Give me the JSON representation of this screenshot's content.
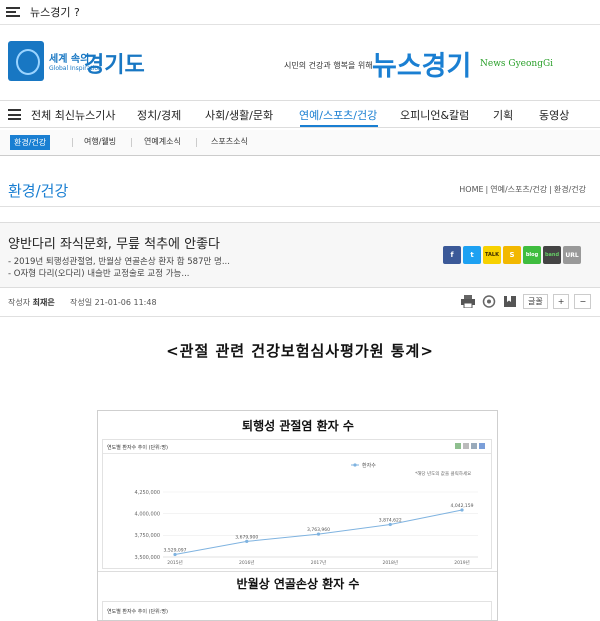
{
  "topbar": {
    "about": "뉴스경기 ?"
  },
  "header": {
    "gg_line1": "세계 속의",
    "gg_line2": "Global Inspiration",
    "gg_name": "경기도",
    "slogan": "시민의 건강과 행복을 위해",
    "brand": "뉴스경기",
    "brand_en": "News GyeongGi"
  },
  "nav": {
    "items": [
      {
        "label": "전체 최신뉴스기사"
      },
      {
        "label": "정치/경제"
      },
      {
        "label": "사회/생활/문화"
      },
      {
        "label": "연예/스포츠/건강"
      },
      {
        "label": "오피니언&칼럼"
      },
      {
        "label": "기획"
      },
      {
        "label": "동영상"
      }
    ]
  },
  "subnav": {
    "items": [
      {
        "label": "환경/건강"
      },
      {
        "label": "여행/웰빙"
      },
      {
        "label": "연예계소식"
      },
      {
        "label": "스포츠소식"
      }
    ]
  },
  "section": {
    "title": "환경/건강",
    "crumbs": [
      "HOME",
      "연예/스포츠/건강",
      "환경/건강"
    ]
  },
  "article": {
    "title": "양반다리 좌식문화, 무릎 척추에 안좋다",
    "summary1": "- 2019년 퇴행성관절염, 반월상 연골손상 환자 합 587만 명...",
    "summary2": "- O자형 다리(오다리) 내슬반 교정술로 교정 가능...",
    "author_label": "작성자",
    "author": "최재은",
    "date_label": "작성일",
    "date": "21-01-06 11:48",
    "font_label": "글꼴",
    "font_plus": "+",
    "font_minus": "−",
    "heading": "<관절 관련 건강보험심사평가원 통계>"
  },
  "share": {
    "facebook": "f",
    "twitter": "t",
    "kakaotalk": "TALK",
    "kakaostory": "S",
    "blog": "blog",
    "band": "band",
    "url": "URL"
  },
  "chart_panel": {
    "section_title": "퇴행성 관절염 환자 수",
    "panel_title": "연도별 환자수 추이 (단위:명)",
    "hint": "*해당 년도의 값을 클릭하세요",
    "second_title": "반월상 연골손상 환자 수",
    "second_panel_title": "연도별 환자수 추이 (단위:명)"
  },
  "chart_data": {
    "type": "line",
    "title": "연도별 환자수 추이 (단위:명)",
    "categories": [
      "2015년",
      "2016년",
      "2017년",
      "2018년",
      "2019년"
    ],
    "series": [
      {
        "name": "환자수",
        "values": [
          3529097,
          3679900,
          3763960,
          3874622,
          4042159
        ]
      }
    ],
    "value_labels": [
      "3,529,097",
      "3,679,900",
      "3,763,960",
      "3,874,622",
      "4,042,159"
    ],
    "yticks": [
      "4,250,000",
      "4,000,000",
      "3,750,000",
      "3,500,000"
    ],
    "ytick_values": [
      4250000,
      4000000,
      3750000,
      3500000
    ],
    "ylim": [
      3500000,
      4250000
    ],
    "grid": true,
    "legend": "top-right",
    "color": "#7fb3e0"
  }
}
